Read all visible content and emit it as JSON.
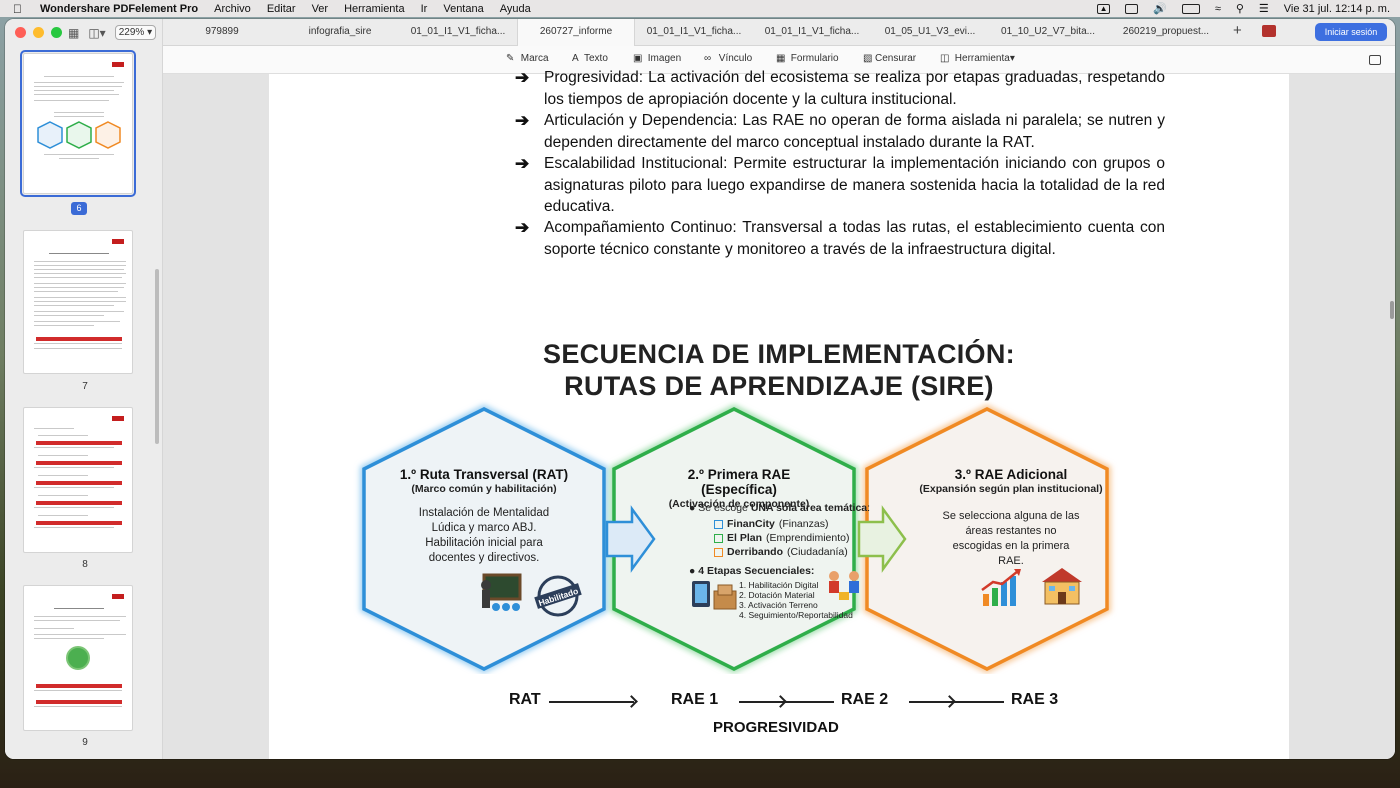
{
  "menubar": {
    "app_name": "Wondershare PDFelement Pro",
    "menus": [
      "Archivo",
      "Editar",
      "Ver",
      "Herramienta",
      "Ir",
      "Ventana",
      "Ayuda"
    ],
    "clock": "Vie 31 jul.  12:14 p. m."
  },
  "sidebar": {
    "zoom": "229%",
    "thumbs": [
      {
        "page": "6",
        "selected": true
      },
      {
        "page": "7",
        "selected": false
      },
      {
        "page": "8",
        "selected": false
      },
      {
        "page": "9",
        "selected": false
      }
    ]
  },
  "tabs": [
    {
      "label": "979899",
      "active": false
    },
    {
      "label": "infografia_sire",
      "active": false
    },
    {
      "label": "01_01_I1_V1_ficha...",
      "active": false
    },
    {
      "label": "260727_informe",
      "active": true
    },
    {
      "label": "01_01_I1_V1_ficha...",
      "active": false
    },
    {
      "label": "01_01_I1_V1_ficha...",
      "active": false
    },
    {
      "label": "01_05_U1_V3_evi...",
      "active": false
    },
    {
      "label": "01_10_U2_V7_bita...",
      "active": false
    },
    {
      "label": "260219_propuest...",
      "active": false
    }
  ],
  "signin_label": "Iniciar sesión",
  "toolbar": {
    "tools": [
      {
        "label": "Marca",
        "icon": "pen-icon"
      },
      {
        "label": "Texto",
        "icon": "text-icon"
      },
      {
        "label": "Imagen",
        "icon": "image-icon"
      },
      {
        "label": "Vínculo",
        "icon": "link-icon"
      },
      {
        "label": "Formulario",
        "icon": "form-icon"
      },
      {
        "label": "Censurar",
        "icon": "redact-icon"
      },
      {
        "label": "Herramienta",
        "icon": "toolbox-icon"
      }
    ]
  },
  "document": {
    "bullets": [
      "Progresividad: La activación del ecosistema se realiza por etapas graduadas, respetando los tiempos de apropiación docente y la cultura institucional.",
      "Articulación y Dependencia: Las RAE no operan de forma aislada ni paralela; se nutren y dependen directamente del marco conceptual instalado durante la RAT.",
      "Escalabilidad Institucional: Permite estructurar la implementación iniciando con grupos o asignaturas piloto para luego expandirse de manera sostenida hacia la totalidad de la red educativa.",
      "Acompañamiento Continuo: Transversal a todas las rutas, el establecimiento cuenta con soporte técnico constante y monitoreo a través de la infraestructura digital."
    ],
    "infographic": {
      "title_line1": "SECUENCIA DE IMPLEMENTACIÓN:",
      "title_line2": "RUTAS DE APRENDIZAJE (SIRE)",
      "hex1": {
        "heading": "1.º Ruta Transversal (RAT)",
        "subheading": "(Marco común y habilitación)",
        "body": "Instalación de Mentalidad Lúdica y marco ABJ. Habilitación inicial para docentes y directivos.",
        "stamp": "Habilitado",
        "color": "#2e8fd8"
      },
      "hex2": {
        "heading": "2.º Primera RAE (Específica)",
        "subheading": "(Activación de componente)",
        "intro_prefix": "Se escoge ",
        "intro_bold": "UNA sola área temática",
        "intro_suffix": ":",
        "options": [
          {
            "bold": "FinanCity",
            "rest": " (Finanzas)",
            "color": "#2e8fd8"
          },
          {
            "bold": "El Plan",
            "rest": " (Emprendimiento)",
            "color": "#2fae4a"
          },
          {
            "bold": "Derribando",
            "rest": " (Ciudadanía)",
            "color": "#f08a24"
          }
        ],
        "stages_title": "4 Etapas Secuenciales:",
        "stages": [
          "1. Habilitación Digital",
          "2. Dotación Material",
          "3. Activación Terreno",
          "4. Seguimiento/Reportabilidad"
        ],
        "color": "#2fae4a"
      },
      "hex3": {
        "heading": "3.º RAE Adicional",
        "subheading": "(Expansión según plan institucional)",
        "body": "Se selecciona alguna de las áreas restantes no escogidas en la primera RAE.",
        "color": "#f08a24"
      },
      "flow": [
        "RAT",
        "RAE 1",
        "RAE 2",
        "RAE 3"
      ],
      "flow_caption": "PROGRESIVIDAD"
    }
  }
}
